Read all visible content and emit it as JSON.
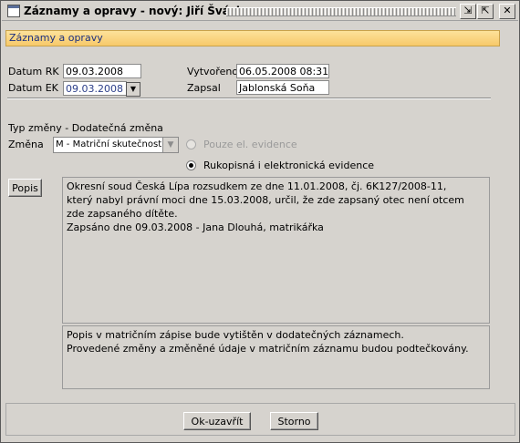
{
  "window": {
    "title": "Záznamy a opravy - nový: Jiří Švácha"
  },
  "panel": {
    "header": "Záznamy a opravy"
  },
  "form": {
    "datum_rk_label": "Datum RK",
    "datum_rk_value": "09.03.2008",
    "datum_ek_label": "Datum EK",
    "datum_ek_value": "09.03.2008",
    "vytvoreno_label": "Vytvořeno",
    "vytvoreno_value": "06.05.2008 08:31",
    "zapsal_label": "Zapsal",
    "zapsal_value": "Jablonská Soňa",
    "typ_zmeny": "Typ změny - Dodatečná změna",
    "zmena_label": "Změna",
    "zmena_value": "M - Matriční skutečnost",
    "radio_pouze": "Pouze el. evidence",
    "radio_rukopisna": "Rukopisná i elektronická evidence",
    "popis_button": "Popis",
    "popis_text": "Okresní soud Česká Lípa rozsudkem ze dne 11.01.2008, čj. 6K127/2008-11,\nkterý nabyl právní moci dne 15.03.2008, určil, že zde zapsaný otec není otcem\nzde zapsaného dítěte.\nZapsáno dne 09.03.2008 - Jana Dlouhá, matrikářka",
    "note_text": "Popis v matričním zápise bude vytištěn v dodatečných záznamech.\nProvedené změny a změněné údaje v matričním záznamu budou podtečkovány."
  },
  "buttons": {
    "ok": "Ok-uzavřít",
    "storno": "Storno"
  }
}
